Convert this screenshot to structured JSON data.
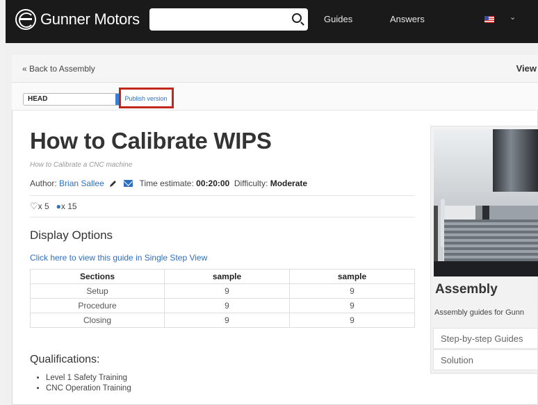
{
  "header": {
    "brand": "Gunner Motors",
    "search": {
      "value": "",
      "placeholder": ""
    },
    "nav": [
      "Guides",
      "Answers"
    ],
    "locale_flag": "us-flag-icon"
  },
  "breadcrumb": {
    "back_label": "« Back to Assembly",
    "view_label": "View"
  },
  "toolbar": {
    "version_select": "HEAD",
    "publish_label": "Publish version",
    "highlight_color": "#c0281c"
  },
  "guide": {
    "title": "How to Calibrate WIPS",
    "subtitle": "How to Calibrate a CNC machine",
    "author_label": "Author:",
    "author_name": "Brian Sallee",
    "time_label": "Time estimate:",
    "time_value": "00:20:00",
    "difficulty_label": "Difficulty:",
    "difficulty_value": "Moderate",
    "favorites": "x 5",
    "comments": "x 15"
  },
  "display_options": {
    "heading": "Display Options",
    "single_step_link": "Click here to view this guide in Single Step View",
    "table": {
      "headers": [
        "Sections",
        "sample",
        "sample"
      ],
      "rows": [
        [
          "Setup",
          "9",
          "9"
        ],
        [
          "Procedure",
          "9",
          "9"
        ],
        [
          "Closing",
          "9",
          "9"
        ]
      ]
    }
  },
  "qualifications": {
    "heading": "Qualifications:",
    "items": [
      "Level 1 Safety Training",
      "CNC Operation Training"
    ]
  },
  "sidebar": {
    "title": "Assembly",
    "description": "Assembly guides for Gunn",
    "items": [
      "Step-by-step Guides",
      "Solution"
    ]
  },
  "colors": {
    "topbar": "#1a1a1a",
    "link": "#2f6fbf",
    "select_accent": "#3a7fd8"
  }
}
